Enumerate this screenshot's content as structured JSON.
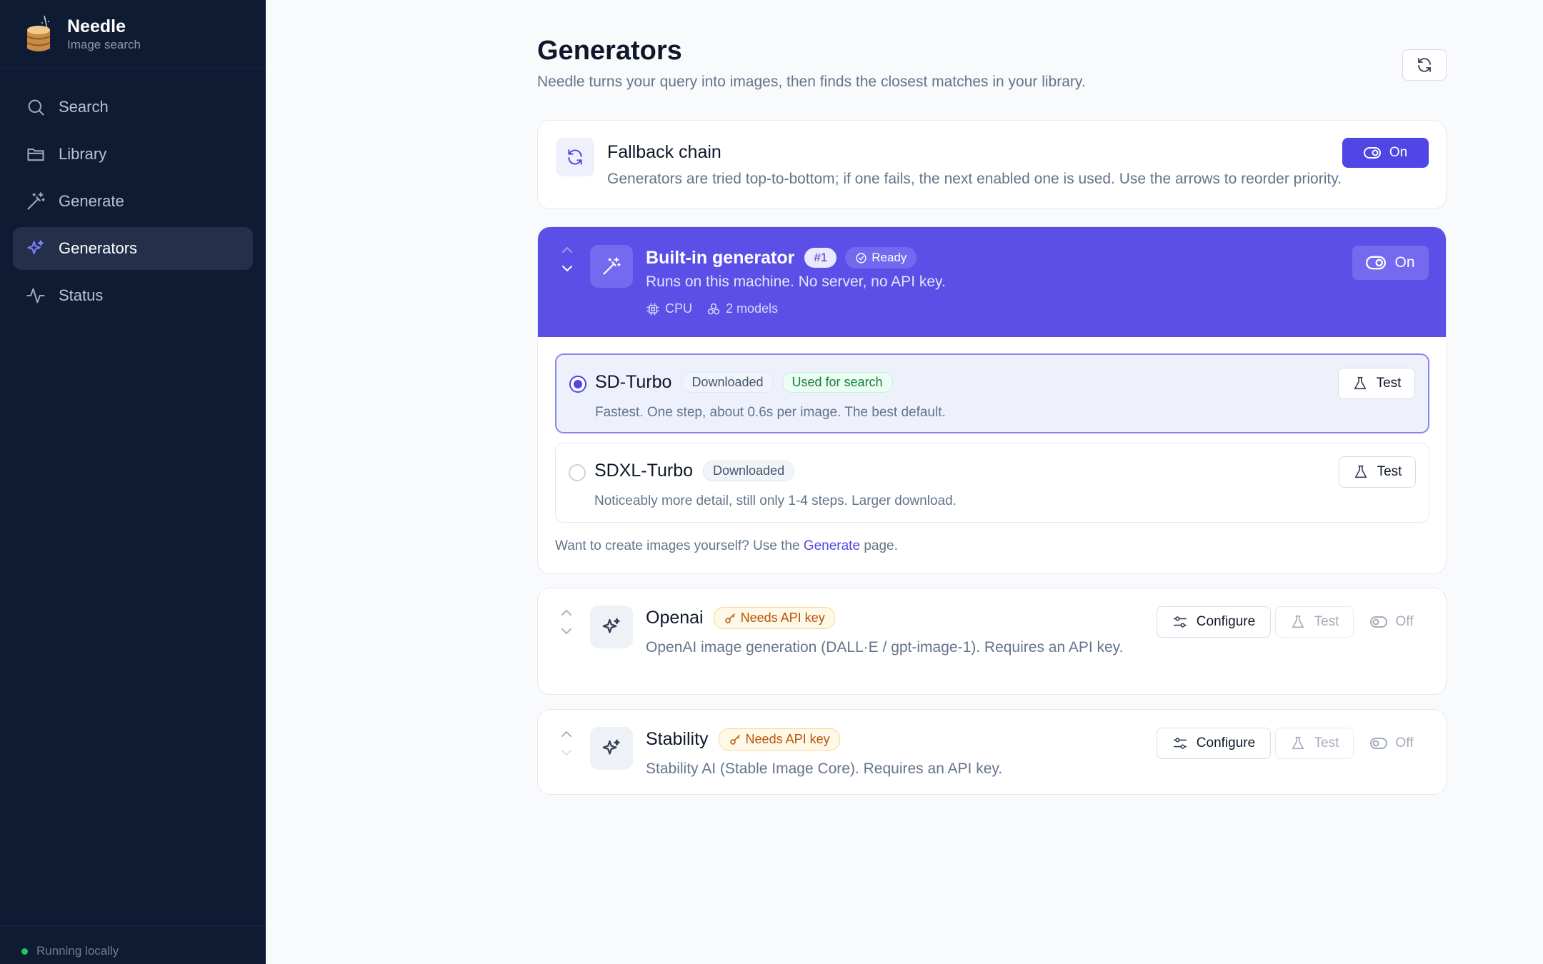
{
  "sidebar": {
    "brand_name": "Needle",
    "brand_sub": "Image search",
    "items": [
      {
        "label": "Search",
        "icon": "search-icon"
      },
      {
        "label": "Library",
        "icon": "folder-icon"
      },
      {
        "label": "Generate",
        "icon": "magic-wand-icon"
      },
      {
        "label": "Generators",
        "icon": "sparkles-icon",
        "active": true
      },
      {
        "label": "Status",
        "icon": "activity-icon"
      }
    ],
    "footer_status": "Running locally"
  },
  "header": {
    "title": "Generators",
    "subtitle": "Needle turns your query into images, then finds the closest matches in your library.",
    "refresh_icon": "refresh-icon"
  },
  "fallback": {
    "title": "Fallback chain",
    "description": "Generators are tried top-to-bottom; if one fails, the next enabled one is used. Use the arrows to reorder priority.",
    "toggle_label": "On"
  },
  "builtin": {
    "name": "Built-in generator",
    "priority": "#1",
    "status": "Ready",
    "description": "Runs on this machine. No server, no API key.",
    "device": "CPU",
    "models_count": "2 models",
    "toggle_label": "On",
    "models": [
      {
        "name": "SD-Turbo",
        "badges": [
          "Downloaded",
          "Used for search"
        ],
        "description": "Fastest. One step, about 0.6s per image. The best default.",
        "selected": true,
        "test_label": "Test"
      },
      {
        "name": "SDXL-Turbo",
        "badges": [
          "Downloaded"
        ],
        "description": "Noticeably more detail, still only 1-4 steps. Larger download.",
        "selected": false,
        "test_label": "Test"
      }
    ],
    "footer_prefix": "Want to create images yourself? Use the",
    "footer_link": "Generate",
    "footer_suffix": "page."
  },
  "providers": [
    {
      "name": "Openai",
      "badge": "Needs API key",
      "description": "OpenAI image generation (DALL·E / gpt-image-1). Requires an API key.",
      "configure_label": "Configure",
      "test_label": "Test",
      "toggle_label": "Off"
    },
    {
      "name": "Stability",
      "badge": "Needs API key",
      "description": "Stability AI (Stable Image Core). Requires an API key.",
      "configure_label": "Configure",
      "test_label": "Test",
      "toggle_label": "Off"
    }
  ],
  "colors": {
    "accent": "#4f46e5",
    "sidebar_bg": "#0f1b33",
    "header_bg": "#5b4fe8",
    "ready_green": "#22c55e",
    "amber": "#b45309"
  }
}
